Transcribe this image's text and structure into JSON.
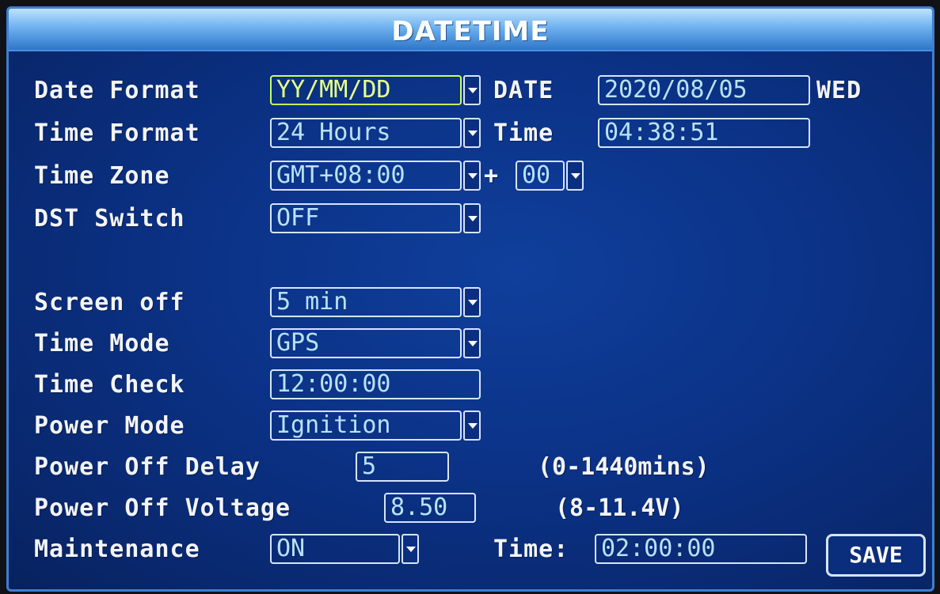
{
  "title": "DATETIME",
  "date_format": {
    "label": "Date Format",
    "value": "YY/MM/DD"
  },
  "date": {
    "label": "DATE",
    "value": "2020/08/05",
    "weekday": "WED"
  },
  "time_format": {
    "label": "Time Format",
    "value": "24 Hours"
  },
  "time": {
    "label": "Time",
    "value": "04:38:51"
  },
  "time_zone": {
    "label": "Time Zone",
    "value": "GMT+08:00",
    "plus": "+",
    "offset": "00"
  },
  "dst_switch": {
    "label": "DST Switch",
    "value": "OFF"
  },
  "screen_off": {
    "label": "Screen off",
    "value": "5 min"
  },
  "time_mode": {
    "label": "Time Mode",
    "value": "GPS"
  },
  "time_check": {
    "label": "Time Check",
    "value": "12:00:00"
  },
  "power_mode": {
    "label": "Power Mode",
    "value": "Ignition"
  },
  "power_off_delay": {
    "label": "Power Off Delay",
    "value": "5",
    "hint": "(0-1440mins)"
  },
  "power_off_voltage": {
    "label": "Power Off Voltage",
    "value": "8.50",
    "hint": "(8-11.4V)"
  },
  "maintenance": {
    "label": "Maintenance",
    "value": "ON",
    "time_label": "Time:",
    "time_value": "02:00:00"
  },
  "save_label": "SAVE",
  "colors": {
    "background": "#0b3286",
    "title_bar": "#6fb2ef",
    "selected_border": "#c8ff58",
    "field_text": "#b9e1ff"
  }
}
